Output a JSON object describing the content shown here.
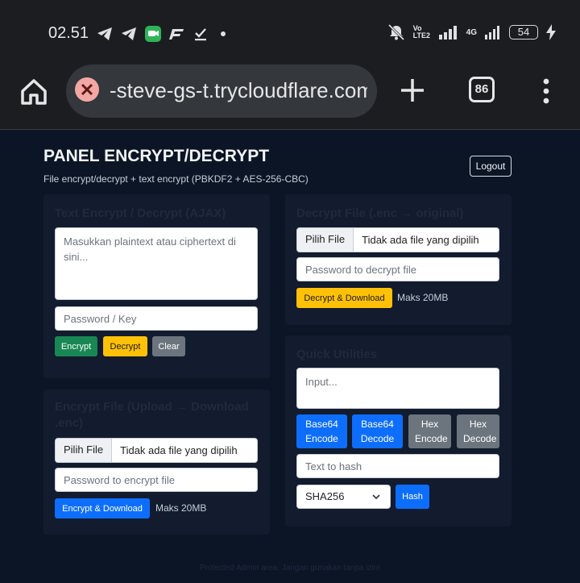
{
  "status_bar": {
    "time": "02.51",
    "battery": "54",
    "network": "4G",
    "volte": "Vo LTE2",
    "icons": [
      "telegram-icon",
      "telegram-icon",
      "messages-icon",
      "app-icon",
      "download-done-icon",
      "dot-icon",
      "mute-icon",
      "signal-icon",
      "charging-icon"
    ]
  },
  "browser": {
    "url": "-steve-gs-t.trycloudflare.com",
    "tab_count": "86"
  },
  "page": {
    "title": "PANEL ENCRYPT/DECRYPT",
    "subtitle": "File encrypt/decrypt + text encrypt (PBKDF2 + AES-256-CBC)",
    "logout_label": "Logout",
    "footer": "Protected Admin area. Jangan gunakan tanpa izin!"
  },
  "text_card": {
    "title": "Text Encrypt / Decrypt (AJAX)",
    "text_placeholder": "Masukkan plaintext atau ciphertext di sini...",
    "key_placeholder": "Password / Key",
    "encrypt_label": "Encrypt",
    "decrypt_label": "Decrypt",
    "clear_label": "Clear"
  },
  "encrypt_file_card": {
    "title": "Encrypt File (Upload → Download .enc)",
    "choose_label": "Pilih File",
    "no_file": "Tidak ada file yang dipilih",
    "password_placeholder": "Password to encrypt file",
    "button_label": "Encrypt & Download",
    "max_note": "Maks 20MB"
  },
  "decrypt_file_card": {
    "title": "Decrypt File (.enc → original)",
    "choose_label": "Pilih File",
    "no_file": "Tidak ada file yang dipilih",
    "password_placeholder": "Password to decrypt file",
    "button_label": "Decrypt & Download",
    "max_note": "Maks 20MB"
  },
  "utilities_card": {
    "title": "Quick Utilities",
    "input_placeholder": "Input...",
    "b64_encode": "Base64 Encode",
    "b64_decode": "Base64 Decode",
    "hex_encode": "Hex Encode",
    "hex_decode": "Hex Decode",
    "hash_placeholder": "Text to hash",
    "hash_algo": "SHA256",
    "hash_label": "Hash"
  }
}
